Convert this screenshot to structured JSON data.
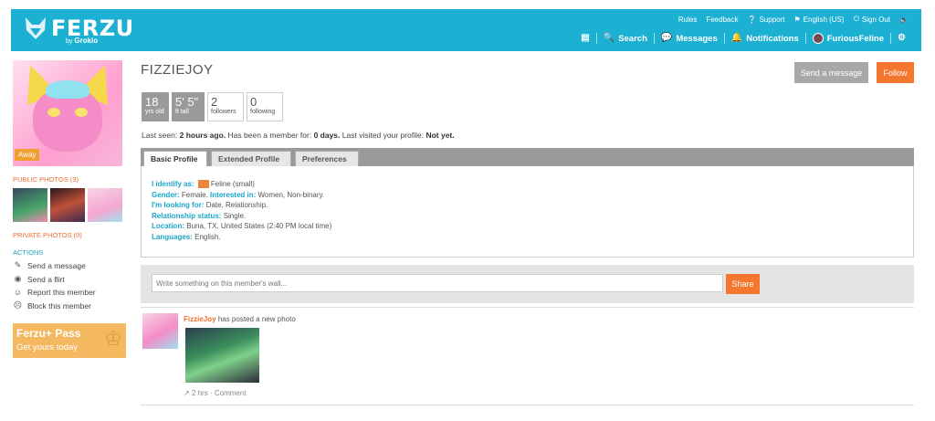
{
  "brand": {
    "name": "FERZU",
    "sub_by": "by",
    "sub_company": "Grokio"
  },
  "toplinks": [
    "Rules",
    "Feedback",
    "Support",
    "English (US)",
    "Sign Out"
  ],
  "mainnav": {
    "search": "Search",
    "messages": "Messages",
    "notifications": "Notifications",
    "user": "FuriousFeline"
  },
  "sidebar": {
    "away_badge": "Away",
    "public_photos": "PUBLIC PHOTOS (3)",
    "private_photos": "PRIVATE PHOTOS (0)",
    "actions_head": "ACTIONS",
    "actions": [
      "Send a message",
      "Send a flirt",
      "Report this member",
      "Block this member"
    ],
    "pass_title": "Ferzu+ Pass",
    "pass_sub": "Get yours today"
  },
  "profile": {
    "username": "FIZZIEJOY",
    "send_message": "Send a message",
    "follow": "Follow",
    "stats": [
      {
        "num": "18",
        "label": "yrs old"
      },
      {
        "num": "5' 5\"",
        "label": "ft tall"
      },
      {
        "num": "2",
        "label": "followers"
      },
      {
        "num": "0",
        "label": "following"
      }
    ],
    "last_seen_label": "Last seen:",
    "last_seen_value": "2 hours ago.",
    "member_for_label": "Has been a member for:",
    "member_for_value": "0 days.",
    "last_visited_label": "Last visited your profile:",
    "last_visited_value": "Not yet."
  },
  "tabs": [
    "Basic Profile",
    "Extended Profile",
    "Preferences"
  ],
  "basic": {
    "identify_k": "I identify as:",
    "identify_v": "Feline (small)",
    "gender_k": "Gender:",
    "gender_v": "Female.",
    "interested_k": "Interested in:",
    "interested_v": "Women, Non-binary.",
    "looking_k": "I'm looking for:",
    "looking_v": "Date, Relationship.",
    "relationship_k": "Relationship status:",
    "relationship_v": "Single.",
    "location_k": "Location:",
    "location_v": "Buna, TX, United States (2:40 PM local time)",
    "languages_k": "Languages:",
    "languages_v": "English."
  },
  "wall": {
    "placeholder": "Write something on this member's wall...",
    "share": "Share"
  },
  "post": {
    "author": "FizzieJoy",
    "text": "has posted a new photo",
    "time": "2 hrs",
    "sep": "·",
    "comment": "Comment"
  },
  "colors": {
    "header": "#1cb0d3",
    "accent_orange": "#f5762e",
    "link_blue": "#1aa6c9"
  }
}
